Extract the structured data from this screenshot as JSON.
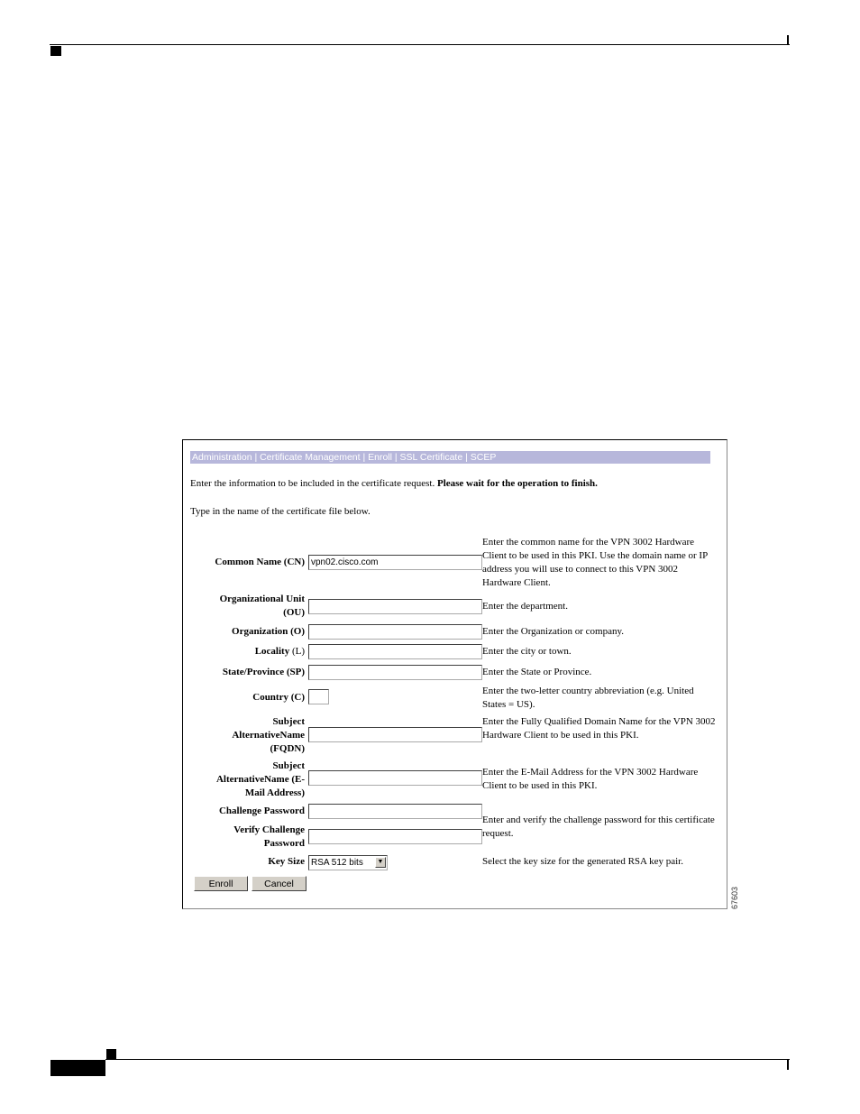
{
  "figure_id": "67603",
  "breadcrumb": "Administration | Certificate Management | Enroll | SSL Certificate | SCEP",
  "intro": {
    "text": "Enter the information to be included in the certificate request. ",
    "bold": "Please wait for the operation to finish."
  },
  "subintro": "Type in the name of the certificate file below.",
  "fields": {
    "cn": {
      "label": "Common Name (CN)",
      "value": "vpn02.cisco.com",
      "help": "Enter the common name for the VPN 3002 Hardware Client to be used in this PKI. Use the domain name or IP address you will use to connect to this VPN 3002 Hardware Client."
    },
    "ou": {
      "label_line1": "Organizational Unit",
      "label_line2": "(OU)",
      "value": "",
      "help": "Enter the department."
    },
    "o": {
      "label": "Organization (O)",
      "value": "",
      "help": "Enter the Organization or company."
    },
    "l": {
      "label_bold": "Locality",
      "label_rest": " (L)",
      "value": "",
      "help": "Enter the city or town."
    },
    "sp": {
      "label": "State/Province (SP)",
      "value": "",
      "help": "Enter the State or Province."
    },
    "c": {
      "label": "Country (C)",
      "value": "",
      "help": "Enter the two-letter country abbreviation (e.g. United States = US)."
    },
    "fqdn": {
      "label_line1": "Subject",
      "label_line2": "AlternativeName",
      "label_line3": "(FQDN)",
      "value": "",
      "help": "Enter the Fully Qualified Domain Name for the VPN 3002 Hardware Client to be used in this PKI."
    },
    "email": {
      "label_line1": "Subject",
      "label_line2": "AlternativeName (E-",
      "label_line3": "Mail Address)",
      "value": "",
      "help": "Enter the E-Mail Address for the VPN 3002 Hardware Client to be used in this PKI."
    },
    "challenge": {
      "label": "Challenge Password",
      "value": ""
    },
    "verify": {
      "label_line1": "Verify Challenge",
      "label_line2": "Password",
      "value": ""
    },
    "password_help": "Enter and verify the challenge password for this certificate request.",
    "keysize": {
      "label": "Key Size",
      "selected": "RSA 512 bits",
      "help": "Select the key size for the generated RSA key pair."
    }
  },
  "buttons": {
    "enroll": "Enroll",
    "cancel": "Cancel"
  },
  "icons": {
    "select_arrow": "▼"
  }
}
